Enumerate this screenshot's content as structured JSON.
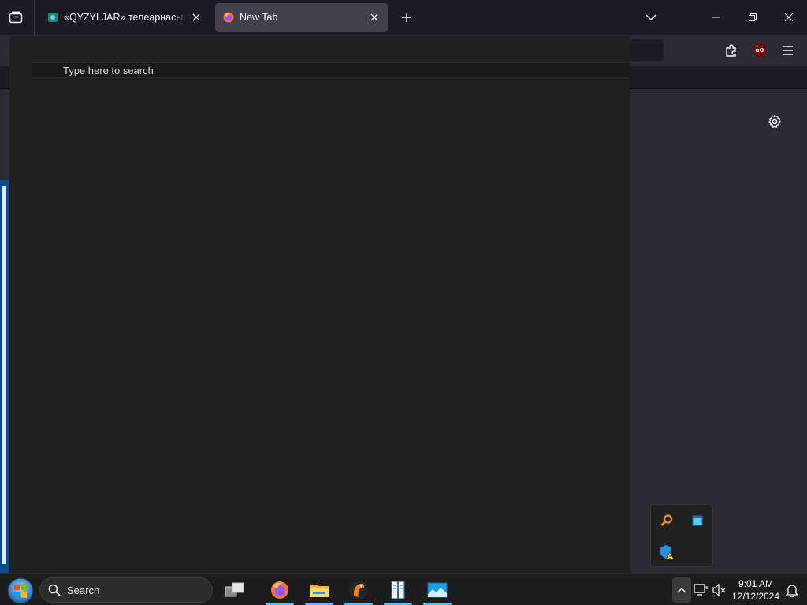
{
  "browser": {
    "tabs": [
      {
        "title": "«QYZYLJAR» телеарнасының ресми сайты",
        "active": false,
        "favicon": "qyzyljar-favicon-icon"
      },
      {
        "title": "New Tab",
        "active": true,
        "favicon": "firefox-favicon-icon"
      }
    ],
    "toolbar_icons": [
      "extensions-icon",
      "ublock-origin-icon",
      "menu-hamburger-icon"
    ],
    "ublock_badge": "uO",
    "accent_color": "#42414d"
  },
  "search_panel": {
    "placeholder": "Type here to search"
  },
  "tray_flyout": {
    "icons": [
      "orange-search-tool-icon",
      "blue-window-app-icon",
      "windows-security-warning-icon"
    ]
  },
  "taskbar": {
    "search_label": "Search",
    "apps": [
      {
        "name": "task-view-icon",
        "running": false
      },
      {
        "name": "firefox-icon",
        "running": true
      },
      {
        "name": "file-explorer-icon",
        "running": true
      },
      {
        "name": "orange-bird-app-icon",
        "running": true
      },
      {
        "name": "notebook-app-icon",
        "running": true
      },
      {
        "name": "photo-landscape-app-icon",
        "running": true
      }
    ],
    "tray_icons": [
      "show-hidden-icons-chevron-icon",
      "network-display-icon",
      "volume-muted-icon",
      "notification-bell-icon"
    ],
    "clock": {
      "time": "9:01 AM",
      "date": "12/12/2024"
    }
  }
}
